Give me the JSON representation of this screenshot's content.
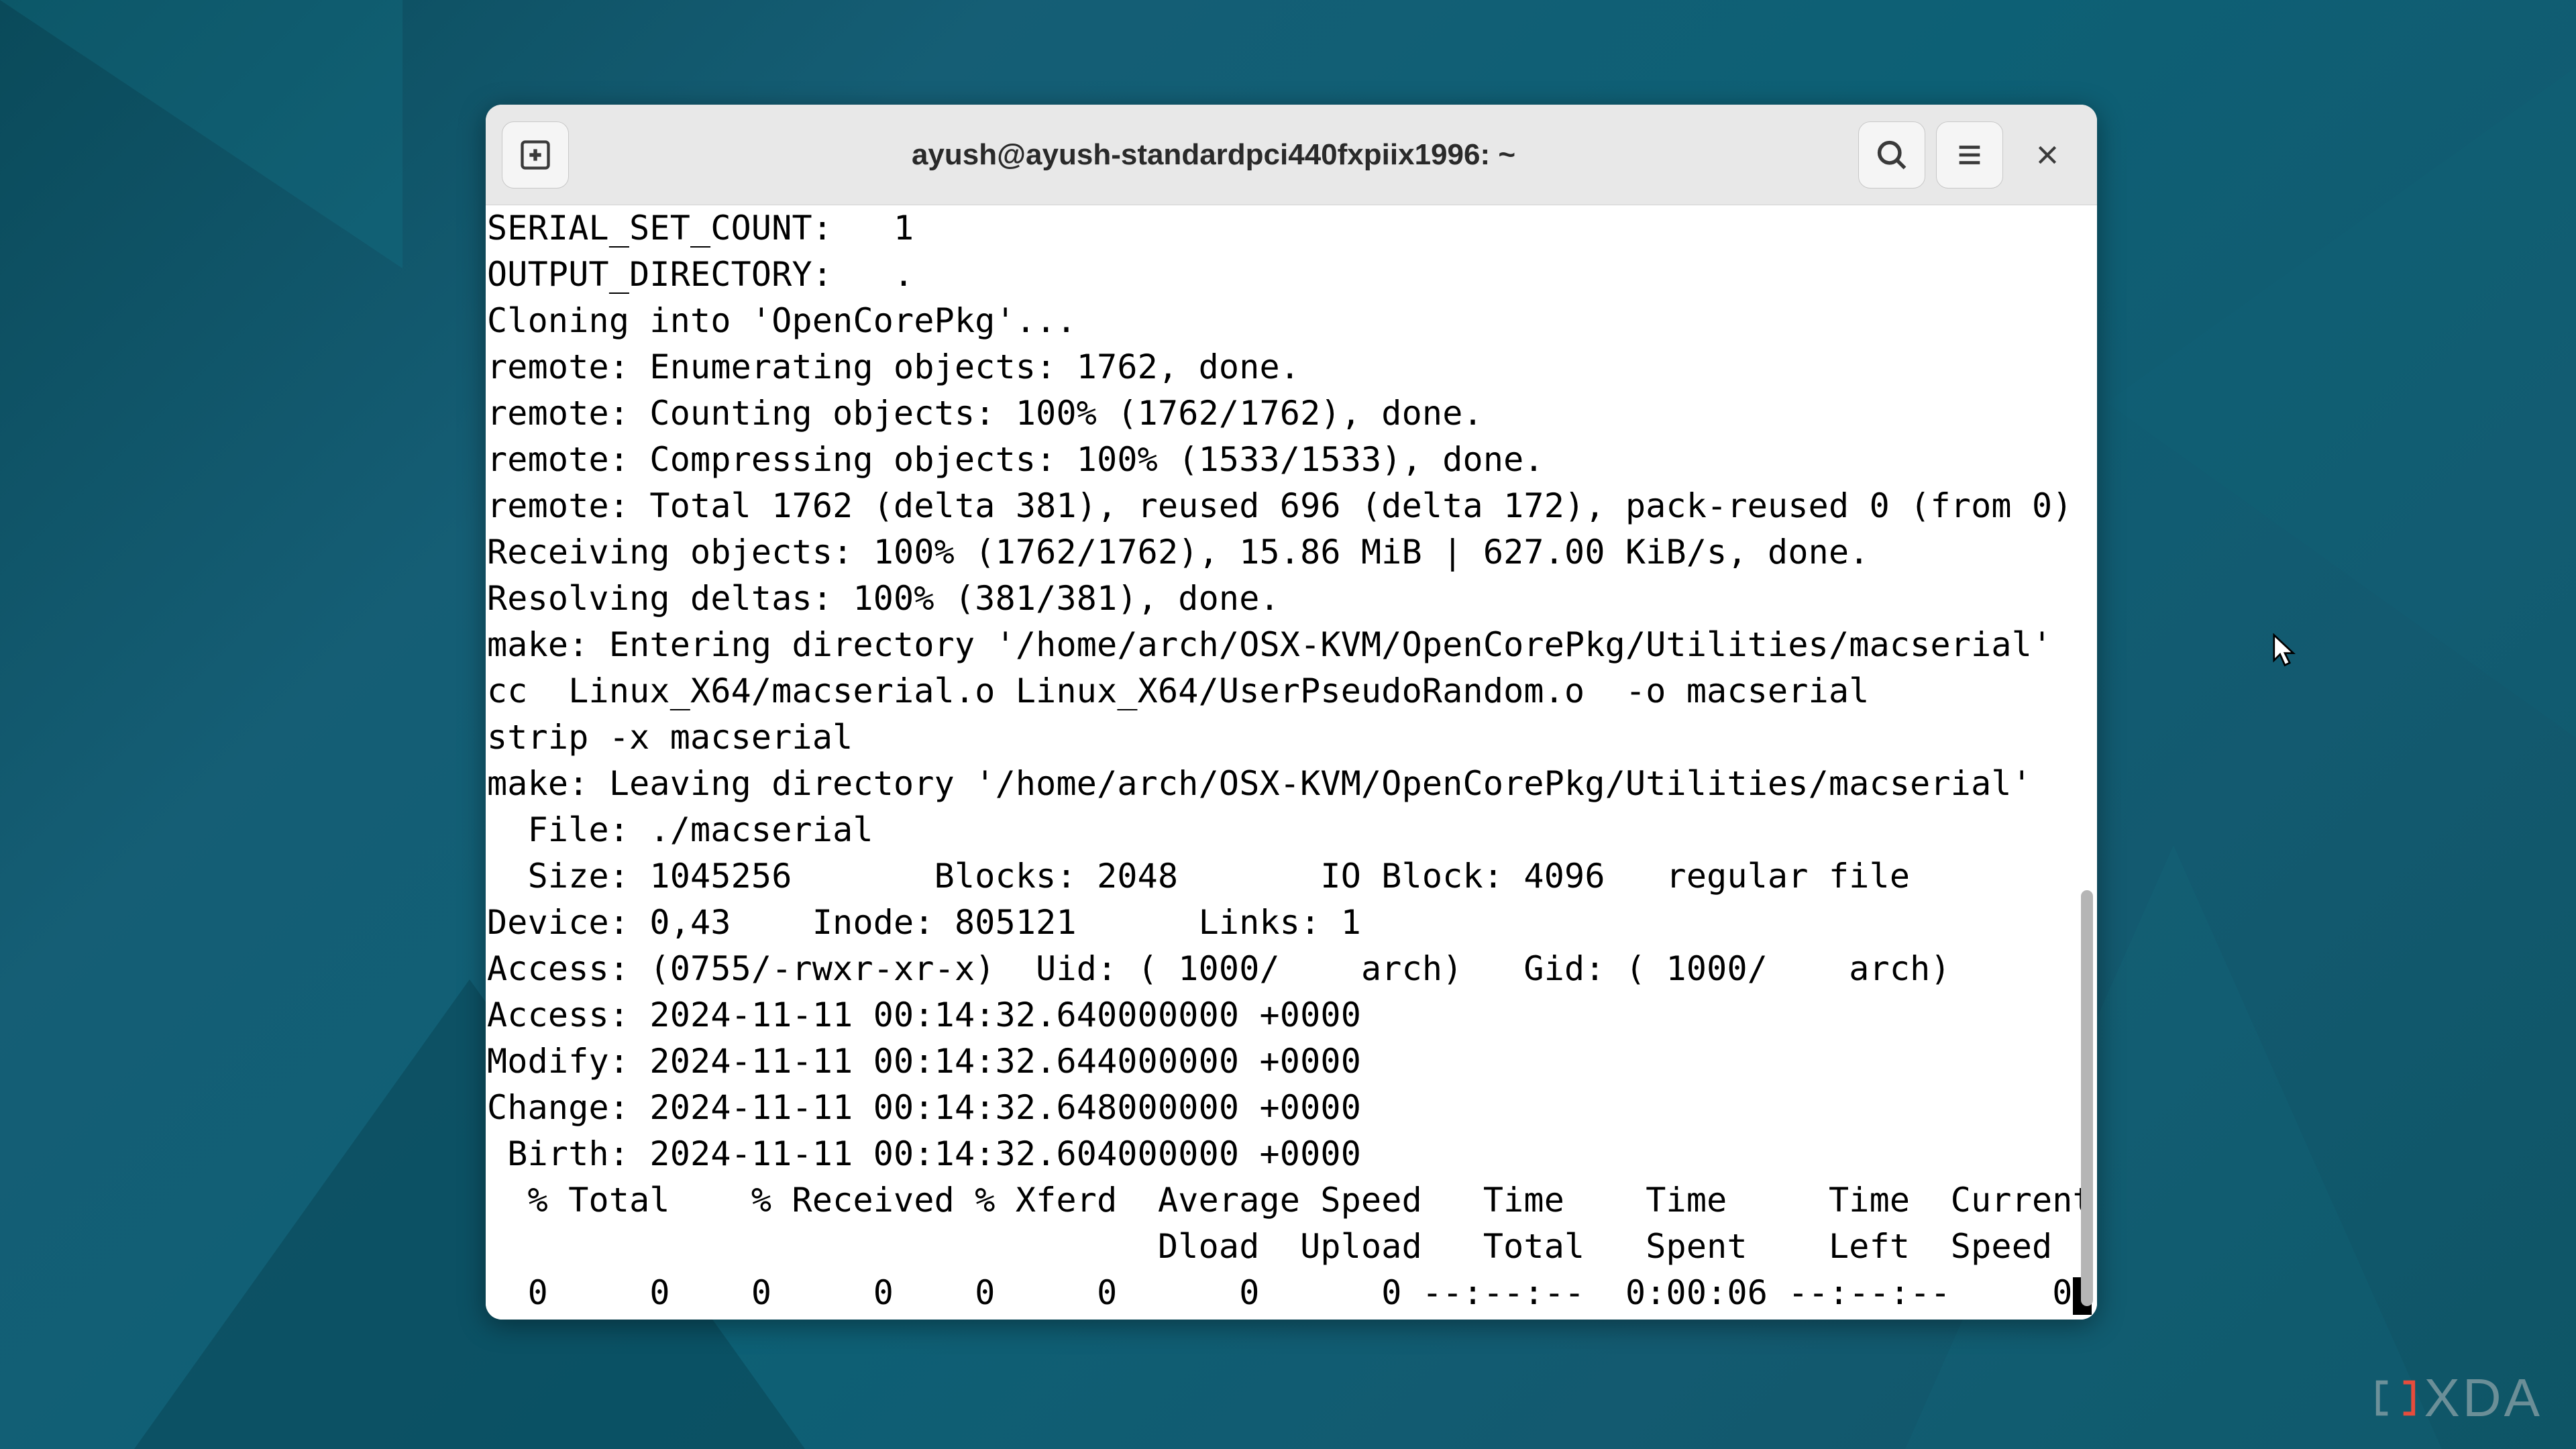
{
  "window": {
    "title": "ayush@ayush-standardpci440fxpiix1996: ~"
  },
  "terminal": {
    "lines": [
      "SERIAL_SET_COUNT:   1",
      "OUTPUT_DIRECTORY:   .",
      "Cloning into 'OpenCorePkg'...",
      "remote: Enumerating objects: 1762, done.",
      "remote: Counting objects: 100% (1762/1762), done.",
      "remote: Compressing objects: 100% (1533/1533), done.",
      "remote: Total 1762 (delta 381), reused 696 (delta 172), pack-reused 0 (from 0)",
      "Receiving objects: 100% (1762/1762), 15.86 MiB | 627.00 KiB/s, done.",
      "Resolving deltas: 100% (381/381), done.",
      "make: Entering directory '/home/arch/OSX-KVM/OpenCorePkg/Utilities/macserial'",
      "cc  Linux_X64/macserial.o Linux_X64/UserPseudoRandom.o  -o macserial",
      "strip -x macserial",
      "make: Leaving directory '/home/arch/OSX-KVM/OpenCorePkg/Utilities/macserial'",
      "  File: ./macserial",
      "  Size: 1045256       Blocks: 2048       IO Block: 4096   regular file",
      "Device: 0,43    Inode: 805121      Links: 1",
      "Access: (0755/-rwxr-xr-x)  Uid: ( 1000/    arch)   Gid: ( 1000/    arch)",
      "Access: 2024-11-11 00:14:32.640000000 +0000",
      "Modify: 2024-11-11 00:14:32.644000000 +0000",
      "Change: 2024-11-11 00:14:32.648000000 +0000",
      " Birth: 2024-11-11 00:14:32.604000000 +0000",
      "  % Total    % Received % Xferd  Average Speed   Time    Time     Time  Current",
      "                                 Dload  Upload   Total   Spent    Left  Speed",
      "  0     0    0     0    0     0      0      0 --:--:--  0:00:06 --:--:--     0"
    ]
  },
  "watermark": {
    "text": "XDA"
  }
}
